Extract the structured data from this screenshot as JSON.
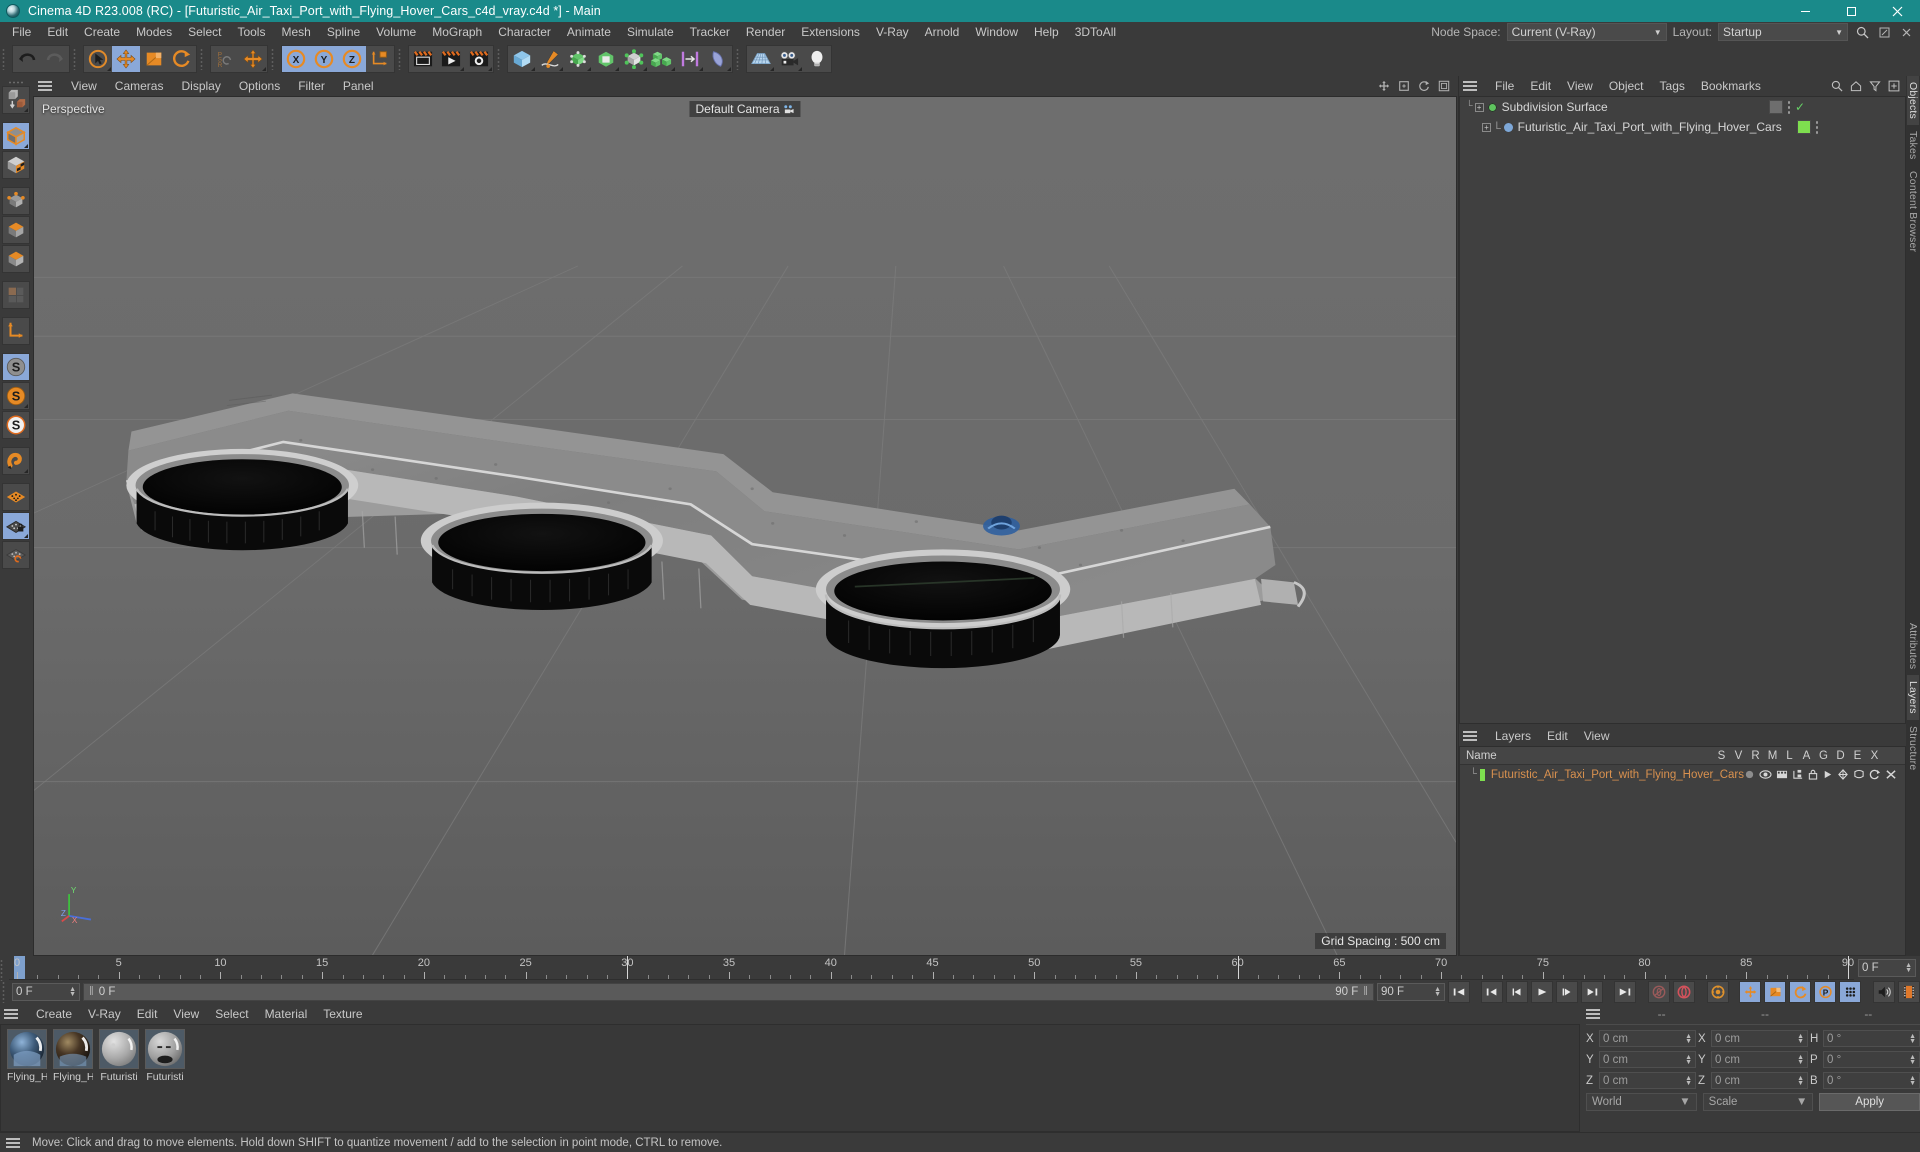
{
  "window": {
    "title": "Cinema 4D R23.008 (RC) - [Futuristic_Air_Taxi_Port_with_Flying_Hover_Cars_c4d_vray.c4d *] - Main",
    "minimize": "–",
    "maximize": "❐",
    "close": "✕"
  },
  "menubar": {
    "items": [
      {
        "label": "File"
      },
      {
        "label": "Edit"
      },
      {
        "label": "Create"
      },
      {
        "label": "Modes"
      },
      {
        "label": "Select"
      },
      {
        "label": "Tools"
      },
      {
        "label": "Mesh"
      },
      {
        "label": "Spline"
      },
      {
        "label": "Volume"
      },
      {
        "label": "MoGraph"
      },
      {
        "label": "Character"
      },
      {
        "label": "Animate"
      },
      {
        "label": "Simulate"
      },
      {
        "label": "Tracker"
      },
      {
        "label": "Render"
      },
      {
        "label": "Extensions"
      },
      {
        "label": "V-Ray"
      },
      {
        "label": "Arnold"
      },
      {
        "label": "Window"
      },
      {
        "label": "Help"
      },
      {
        "label": "3DToAll"
      }
    ],
    "node_space_label": "Node Space:",
    "node_space_value": "Current (V-Ray)",
    "layout_label": "Layout:",
    "layout_value": "Startup"
  },
  "toolbar": {
    "groups": [
      {
        "buttons": [
          {
            "name": "undo-button",
            "icon": "undo",
            "selected": false,
            "dim": false
          },
          {
            "name": "redo-button",
            "icon": "redo",
            "selected": false,
            "dim": true
          }
        ]
      },
      {
        "buttons": [
          {
            "name": "live-selection-tool",
            "icon": "cursor-circle",
            "selected": false,
            "corner": true
          },
          {
            "name": "move-tool",
            "icon": "move-arrows",
            "selected": true
          },
          {
            "name": "scale-tool",
            "icon": "scale-box",
            "selected": false
          },
          {
            "name": "rotate-tool",
            "icon": "rotate-arrows",
            "selected": false
          }
        ]
      },
      {
        "buttons": [
          {
            "name": "psr-lock-tool",
            "icon": "psr",
            "selected": false
          },
          {
            "name": "move-axis-tool",
            "icon": "move-arrows",
            "selected": false,
            "corner": true
          }
        ]
      },
      {
        "buttons": [
          {
            "name": "x-axis-toggle",
            "icon": "axis-x",
            "selected": true
          },
          {
            "name": "y-axis-toggle",
            "icon": "axis-y",
            "selected": true
          },
          {
            "name": "z-axis-toggle",
            "icon": "axis-z",
            "selected": true
          },
          {
            "name": "world-object-axis-toggle",
            "icon": "world-axis",
            "selected": false
          }
        ]
      },
      {
        "buttons": [
          {
            "name": "render-view-button",
            "icon": "render-view",
            "selected": false
          },
          {
            "name": "render-to-picture-viewer-button",
            "icon": "render-picture",
            "selected": false,
            "corner": true
          },
          {
            "name": "render-settings-button",
            "icon": "render-settings",
            "selected": false,
            "corner": true
          }
        ]
      },
      {
        "buttons": [
          {
            "name": "add-cube-button",
            "icon": "cube-blue",
            "selected": false,
            "corner": true
          },
          {
            "name": "add-spline-button",
            "icon": "pen-spline",
            "selected": false,
            "corner": true
          },
          {
            "name": "add-nurbs-button",
            "icon": "nurbs-green",
            "selected": false,
            "corner": true
          },
          {
            "name": "add-subdivision-surface-button",
            "icon": "subdiv-green",
            "selected": false,
            "corner": true
          },
          {
            "name": "add-array-button",
            "icon": "array-gray",
            "selected": false,
            "corner": true
          },
          {
            "name": "add-mograph-cloner-button",
            "icon": "cloner-green",
            "selected": false,
            "corner": true
          },
          {
            "name": "add-deformer-button",
            "icon": "deformer-magenta",
            "selected": false,
            "corner": true
          },
          {
            "name": "add-field-button",
            "icon": "field-blue",
            "selected": false,
            "corner": true
          }
        ]
      },
      {
        "buttons": [
          {
            "name": "add-floor-button",
            "icon": "floor-grid",
            "selected": false,
            "corner": true
          },
          {
            "name": "add-camera-button",
            "icon": "camera",
            "selected": false,
            "corner": true
          },
          {
            "name": "add-light-button",
            "icon": "light-bulb",
            "selected": false,
            "corner": true
          }
        ]
      }
    ]
  },
  "left_tools": [
    {
      "name": "make-editable-button",
      "icon": "make-editable",
      "selected": false,
      "corner": true
    },
    {
      "name": "model-mode-button",
      "icon": "model-cube",
      "selected": true,
      "corner": true
    },
    {
      "name": "texture-mode-button",
      "icon": "texture-cube",
      "selected": false
    },
    {
      "name": "points-mode-button",
      "icon": "points-cube",
      "selected": false
    },
    {
      "name": "edges-mode-button",
      "icon": "edges-cube",
      "selected": false
    },
    {
      "name": "polygons-mode-button",
      "icon": "polygons-cube",
      "selected": false
    },
    {
      "name": "uv-mode-button",
      "icon": "uv-squares",
      "selected": false
    },
    {
      "name": "axis-mode-button",
      "icon": "axis-l",
      "selected": false
    },
    {
      "name": "enable-snapping-button",
      "icon": "snap-s-gray",
      "selected": true
    },
    {
      "name": "snap-settings-button",
      "icon": "snap-s-orange",
      "selected": false,
      "corner": true
    },
    {
      "name": "quantize-button",
      "icon": "snap-s-white",
      "selected": false
    },
    {
      "name": "magnet-tool-button",
      "icon": "magnet",
      "selected": false,
      "corner": true
    },
    {
      "name": "workplane-button",
      "icon": "workplane-orange",
      "selected": false
    },
    {
      "name": "lock-workplane-button",
      "icon": "workplane-lock",
      "selected": true,
      "corner": true
    },
    {
      "name": "align-workplane-button",
      "icon": "workplane-rotate",
      "selected": false
    }
  ],
  "viewport": {
    "menu": [
      {
        "label": "View"
      },
      {
        "label": "Cameras"
      },
      {
        "label": "Display"
      },
      {
        "label": "Options"
      },
      {
        "label": "Filter"
      },
      {
        "label": "Panel"
      }
    ],
    "projection_label": "Perspective",
    "camera_label": "Default Camera",
    "grid_spacing_label": "Grid Spacing : 500 cm",
    "axis_x": "X",
    "axis_y": "Y",
    "axis_z": "Z",
    "background_color": "#6b6b6b"
  },
  "object_manager": {
    "menu": [
      {
        "label": "File"
      },
      {
        "label": "Edit"
      },
      {
        "label": "View"
      },
      {
        "label": "Object"
      },
      {
        "label": "Tags"
      },
      {
        "label": "Bookmarks"
      }
    ],
    "icons": [
      "search-icon",
      "home-icon",
      "filter-icon",
      "add-icon"
    ],
    "rows": [
      {
        "name": "Subdivision Surface",
        "indent": 0,
        "dot": "green",
        "expandable": true
      },
      {
        "name": "Futuristic_Air_Taxi_Port_with_Flying_Hover_Cars",
        "indent": 1,
        "dot": "blue",
        "expandable": true
      }
    ]
  },
  "layer_manager": {
    "menu": [
      {
        "label": "Layers"
      },
      {
        "label": "Edit"
      },
      {
        "label": "View"
      }
    ],
    "name_header": "Name",
    "columns": [
      "S",
      "V",
      "R",
      "M",
      "L",
      "A",
      "G",
      "D",
      "E",
      "X"
    ],
    "rows": [
      {
        "name": "Futuristic_Air_Taxi_Port_with_Flying_Hover_Cars",
        "color": "#7ede4f"
      }
    ]
  },
  "right_tabs": {
    "top": [
      {
        "label": "Objects",
        "active": true
      },
      {
        "label": "Takes",
        "active": false
      },
      {
        "label": "Content Browser",
        "active": false
      }
    ],
    "bottom": [
      {
        "label": "Attributes",
        "active": false
      },
      {
        "label": "Layers",
        "active": true
      },
      {
        "label": "Structure",
        "active": false
      }
    ]
  },
  "timeline": {
    "ticks": [
      0,
      5,
      10,
      15,
      20,
      25,
      30,
      35,
      40,
      45,
      50,
      55,
      60,
      65,
      70,
      75,
      80,
      85,
      90
    ],
    "start_frame": "0 F",
    "current_frame": "0 F",
    "frame_indicator": "0 F",
    "end_frame": "90 F",
    "range_end": "90 F",
    "preview_max": "90 F",
    "playhead_frame": 0,
    "max_frame": 90,
    "transport": [
      {
        "name": "go-to-start-button",
        "icon": "first-frame"
      },
      {
        "name": "go-to-previous-key-button",
        "icon": "prev-key"
      },
      {
        "name": "go-to-previous-frame-button",
        "icon": "prev-frame"
      },
      {
        "name": "play-button",
        "icon": "play"
      },
      {
        "name": "go-to-next-frame-button",
        "icon": "next-frame"
      },
      {
        "name": "go-to-next-key-button",
        "icon": "next-key"
      },
      {
        "name": "go-to-end-button",
        "icon": "last-frame"
      },
      {
        "name": "record-active-objects-button",
        "icon": "record-key"
      },
      {
        "name": "autokeying-button",
        "icon": "autokey"
      },
      {
        "name": "keyframe-selection-button",
        "icon": "key-selection"
      },
      {
        "name": "position-key-button",
        "icon": "pos-key",
        "selected": true
      },
      {
        "name": "scale-key-button",
        "icon": "scale-key",
        "selected": true
      },
      {
        "name": "rotation-key-button",
        "icon": "rot-key",
        "selected": true
      },
      {
        "name": "parameter-key-button",
        "icon": "param-key",
        "selected": true
      },
      {
        "name": "point-level-animation-button",
        "icon": "pla-dots",
        "selected": true
      },
      {
        "name": "sound-button",
        "icon": "sound"
      },
      {
        "name": "film-strip-button",
        "icon": "filmstrip"
      }
    ]
  },
  "material_manager": {
    "menu": [
      {
        "label": "Create"
      },
      {
        "label": "V-Ray"
      },
      {
        "label": "Edit"
      },
      {
        "label": "View"
      },
      {
        "label": "Select"
      },
      {
        "label": "Material"
      },
      {
        "label": "Texture"
      }
    ],
    "materials": [
      {
        "name": "Flying_H",
        "type": "car-blue"
      },
      {
        "name": "Flying_H",
        "type": "car-dark"
      },
      {
        "name": "Futuristi",
        "type": "concrete-light"
      },
      {
        "name": "Futuristi",
        "type": "concrete-dark"
      }
    ]
  },
  "coordinates": {
    "header": [
      "--",
      "--",
      "--"
    ],
    "rows": [
      {
        "pos_axis": "X",
        "pos_value": "0 cm",
        "size_axis": "X",
        "size_value": "0 cm",
        "rot_axis": "H",
        "rot_value": "0 °"
      },
      {
        "pos_axis": "Y",
        "pos_value": "0 cm",
        "size_axis": "Y",
        "size_value": "0 cm",
        "rot_axis": "P",
        "rot_value": "0 °"
      },
      {
        "pos_axis": "Z",
        "pos_value": "0 cm",
        "size_axis": "Z",
        "size_value": "0 cm",
        "rot_axis": "B",
        "rot_value": "0 °"
      }
    ],
    "coord_system": "World",
    "mode": "Scale",
    "apply_label": "Apply"
  },
  "statusbar": {
    "message": "Move: Click and drag to move elements. Hold down SHIFT to quantize movement / add to the selection in point mode, CTRL to remove."
  }
}
